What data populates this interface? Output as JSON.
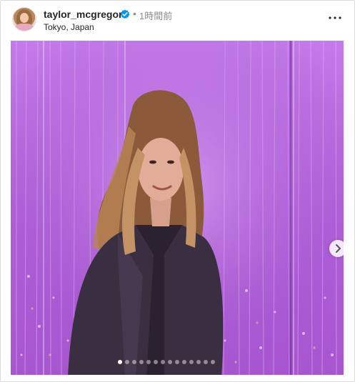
{
  "post": {
    "username": "taylor_mcgregor",
    "separator": "•",
    "time_ago": "1時間前",
    "location": "Tokyo, Japan"
  },
  "icons": {
    "verified": "verified-badge-icon",
    "more": "more-options-icon",
    "next": "chevron-right-icon"
  },
  "carousel": {
    "total_slides": 14,
    "active_index": 0
  },
  "colors": {
    "verified": "#0095f6",
    "text_primary": "#262626",
    "text_secondary": "#8e8e8e",
    "border": "#dbdbdb"
  }
}
